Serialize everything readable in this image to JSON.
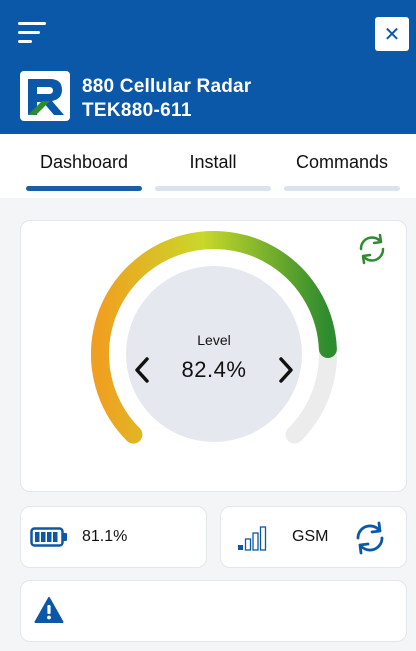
{
  "header": {
    "device_name": "880 Cellular Radar",
    "device_id": "TEK880-611",
    "close_symbol": "✕",
    "brand_color": "#0b58a8"
  },
  "tabs": [
    {
      "label": "Dashboard",
      "active": true
    },
    {
      "label": "Install",
      "active": false
    },
    {
      "label": "Commands",
      "active": false
    }
  ],
  "gauge": {
    "label": "Level",
    "value_text": "82.4%",
    "value_fraction": 0.824,
    "colors": {
      "low": "#f0a020",
      "mid": "#c9d82a",
      "high": "#2e8b2e",
      "track": "#ececec"
    }
  },
  "status": {
    "battery_text": "81.1%",
    "network": "GSM",
    "signal_bars_active": 1,
    "signal_bars_total": 4
  },
  "icons": {
    "menu": "menu-icon",
    "close": "close-icon",
    "refresh": "refresh-icon",
    "battery": "battery-icon",
    "signal": "signal-icon",
    "sync": "sync-icon",
    "warning": "warning-icon"
  }
}
